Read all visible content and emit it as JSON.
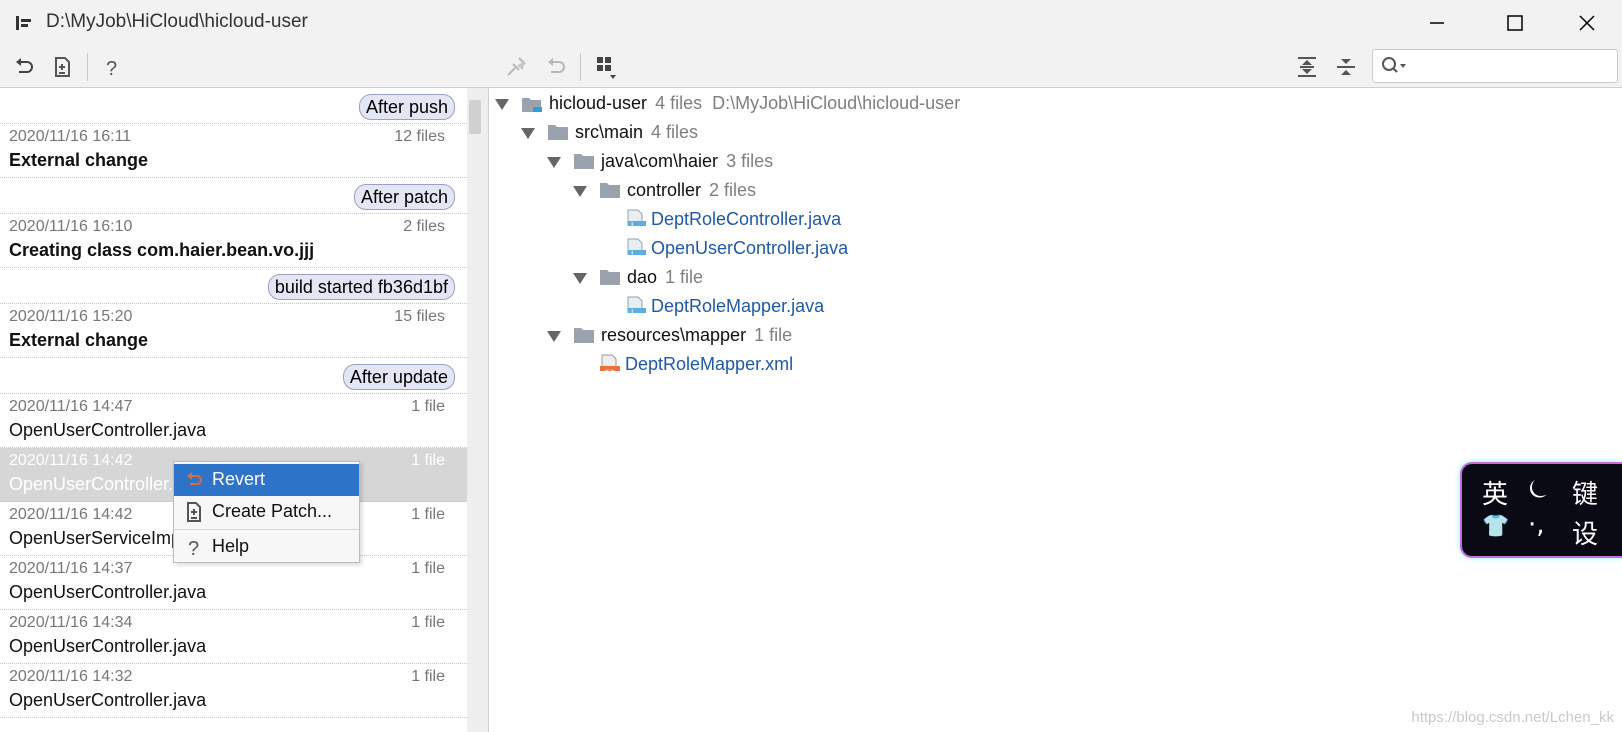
{
  "window": {
    "title": "D:\\MyJob\\HiCloud\\hicloud-user",
    "minimize_glyph": "—",
    "maximize_glyph": "☐",
    "close_glyph": "✕"
  },
  "toolbar": {
    "left_icons": [
      "revert-icon",
      "create-patch-icon",
      "help-icon"
    ],
    "right_icons": [
      "apply-icon",
      "revert-disabled-icon",
      "group-by-icon"
    ],
    "tree_icons": [
      "expand-all-icon",
      "collapse-all-icon"
    ],
    "search_placeholder": ""
  },
  "history": [
    {
      "type": "label",
      "text": "After push"
    },
    {
      "type": "entry",
      "date": "2020/11/16 16:11",
      "count": "12 files",
      "name": "External change",
      "bold": true
    },
    {
      "type": "label",
      "text": "After patch"
    },
    {
      "type": "entry",
      "date": "2020/11/16 16:10",
      "count": "2 files",
      "name": "Creating class com.haier.bean.vo.jjj",
      "bold": true
    },
    {
      "type": "label",
      "text": "build started fb36d1bf"
    },
    {
      "type": "entry",
      "date": "2020/11/16 15:20",
      "count": "15 files",
      "name": "External change",
      "bold": true
    },
    {
      "type": "label",
      "text": "After update"
    },
    {
      "type": "entry",
      "date": "2020/11/16 14:47",
      "count": "1 file",
      "name": "OpenUserController.java",
      "bold": false
    },
    {
      "type": "entry",
      "date": "2020/11/16 14:42",
      "count": "1 file",
      "name": "OpenUserController.java",
      "bold": false,
      "selected": true
    },
    {
      "type": "entry",
      "date": "2020/11/16 14:42",
      "count": "1 file",
      "name": "OpenUserServiceImpl.java",
      "bold": false
    },
    {
      "type": "entry",
      "date": "2020/11/16 14:37",
      "count": "1 file",
      "name": "OpenUserController.java",
      "bold": false
    },
    {
      "type": "entry",
      "date": "2020/11/16 14:34",
      "count": "1 file",
      "name": "OpenUserController.java",
      "bold": false
    },
    {
      "type": "entry",
      "date": "2020/11/16 14:32",
      "count": "1 file",
      "name": "OpenUserController.java",
      "bold": false
    }
  ],
  "context_menu": {
    "items": [
      {
        "label": "Revert",
        "icon": "revert-icon",
        "active": true
      },
      {
        "label": "Create Patch...",
        "icon": "create-patch-icon",
        "active": false
      },
      {
        "label": "Help",
        "icon": "help-icon",
        "active": false
      }
    ]
  },
  "tree": {
    "root": {
      "label": "hicloud-user",
      "count": "4 files",
      "path": "D:\\MyJob\\HiCloud\\hicloud-user"
    },
    "src_main": {
      "label": "src\\main",
      "count": "4 files"
    },
    "java_pkg": {
      "label": "java\\com\\haier",
      "count": "3 files"
    },
    "controller": {
      "label": "controller",
      "count": "2 files"
    },
    "file1": {
      "label": "DeptRoleController.java"
    },
    "file2": {
      "label": "OpenUserController.java"
    },
    "dao": {
      "label": "dao",
      "count": "1 file"
    },
    "file3": {
      "label": "DeptRoleMapper.java"
    },
    "resources": {
      "label": "resources\\mapper",
      "count": "1 file"
    },
    "file4": {
      "label": "DeptRoleMapper.xml"
    }
  },
  "ime": {
    "keys": [
      "英",
      "⏾",
      "键",
      "👕",
      "·,",
      "设"
    ]
  },
  "watermark": "https://blog.csdn.net/Lchen_kk",
  "colors": {
    "accent": "#2d74c9",
    "link": "#1e5aa6",
    "pill_bg": "#e4e6f6",
    "selected_row": "#d6d6d6"
  }
}
